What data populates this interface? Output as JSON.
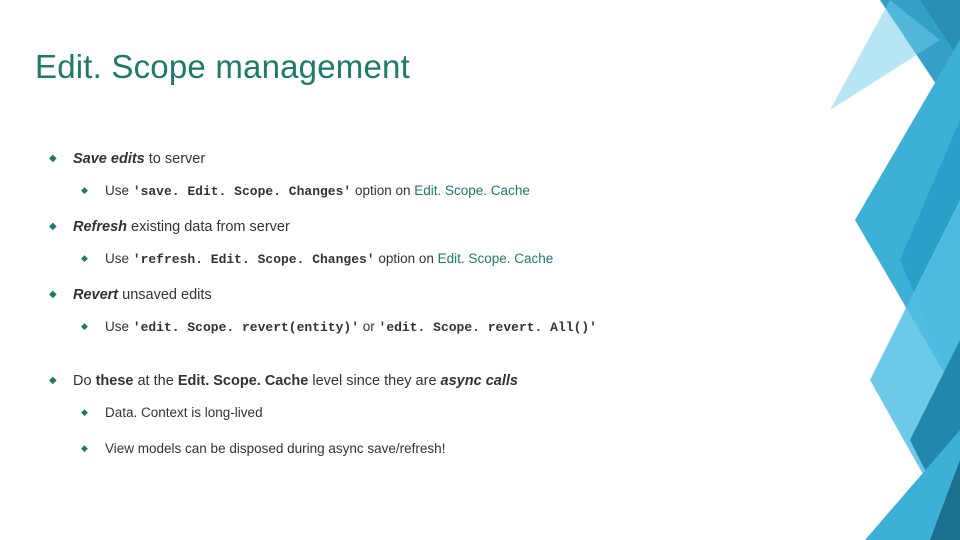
{
  "title": "Edit. Scope management",
  "bullets": {
    "b1": {
      "bold": "Save edits",
      "rest": " to server"
    },
    "b1a_pre": "Use ",
    "b1a_code": "'save. Edit. Scope. Changes'",
    "b1a_mid": " option on ",
    "b1a_teal": "Edit. Scope. Cache",
    "b2": {
      "bold": "Refresh",
      "rest": " existing data from server"
    },
    "b2a_pre": "Use ",
    "b2a_code": "'refresh. Edit. Scope. Changes'",
    "b2a_mid": " option on ",
    "b2a_teal": "Edit. Scope. Cache",
    "b3": {
      "bold": "Revert",
      "rest": " unsaved edits"
    },
    "b3a_pre": "Use ",
    "b3a_code1": "'edit. Scope. revert(entity)'",
    "b3a_mid": " or ",
    "b3a_code2": "'edit. Scope. revert. All()'",
    "b4_pre": "Do ",
    "b4_bold1": "these",
    "b4_mid1": " at the ",
    "b4_bold2": "Edit. Scope. Cache",
    "b4_mid2": " level since they are ",
    "b4_bolditalic": "async calls",
    "b4a": "Data. Context is long-lived",
    "b4b": "View models can be disposed during async save/refresh!"
  }
}
